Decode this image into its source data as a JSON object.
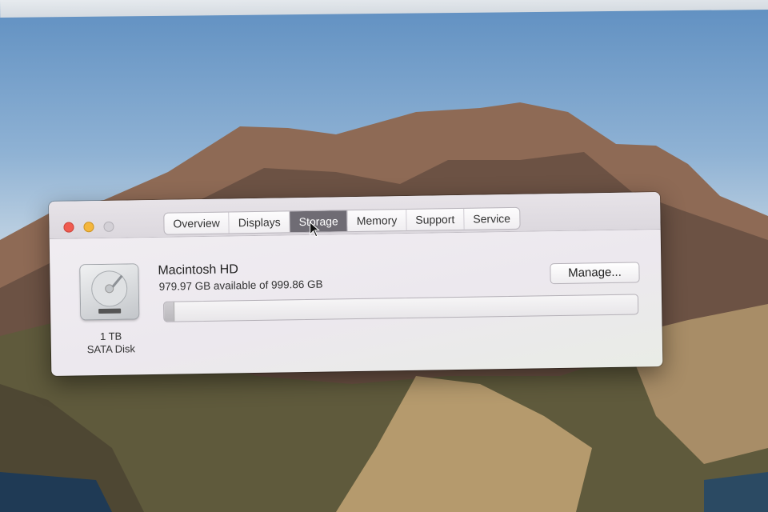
{
  "window": {
    "tabs": [
      {
        "label": "Overview"
      },
      {
        "label": "Displays"
      },
      {
        "label": "Storage",
        "active": true
      },
      {
        "label": "Memory"
      },
      {
        "label": "Support"
      },
      {
        "label": "Service"
      }
    ]
  },
  "disk": {
    "capacity": "1 TB",
    "type": "SATA Disk",
    "icon": "hard-drive-icon"
  },
  "volume": {
    "name": "Macintosh HD",
    "availability": "979.97 GB available of 999.86 GB",
    "used_fraction": 0.02,
    "manage_label": "Manage..."
  },
  "colors": {
    "close": "#f05b50",
    "minimize": "#f4b63c",
    "zoom_inactive": "#d3d0d6",
    "active_tab": "#6f6c74"
  }
}
